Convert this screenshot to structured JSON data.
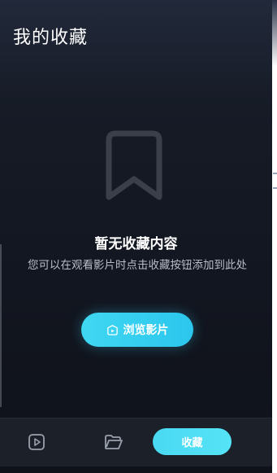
{
  "header": {
    "title": "我的收藏"
  },
  "empty_state": {
    "icon": "bookmark-icon",
    "title": "暂无收藏内容",
    "description": "您可以在观看影片时点击收藏按钮添加到此处",
    "browse_button": {
      "label": "浏览影片",
      "icon": "video-icon"
    }
  },
  "tabbar": {
    "items": [
      {
        "icon": "play-icon"
      },
      {
        "icon": "folder-icon"
      },
      {
        "label": "收藏"
      }
    ]
  },
  "colors": {
    "accent": "#3fd7f1",
    "background": "#12151c",
    "tabbar": "#1c2029",
    "icon_muted": "#3a3f49"
  }
}
